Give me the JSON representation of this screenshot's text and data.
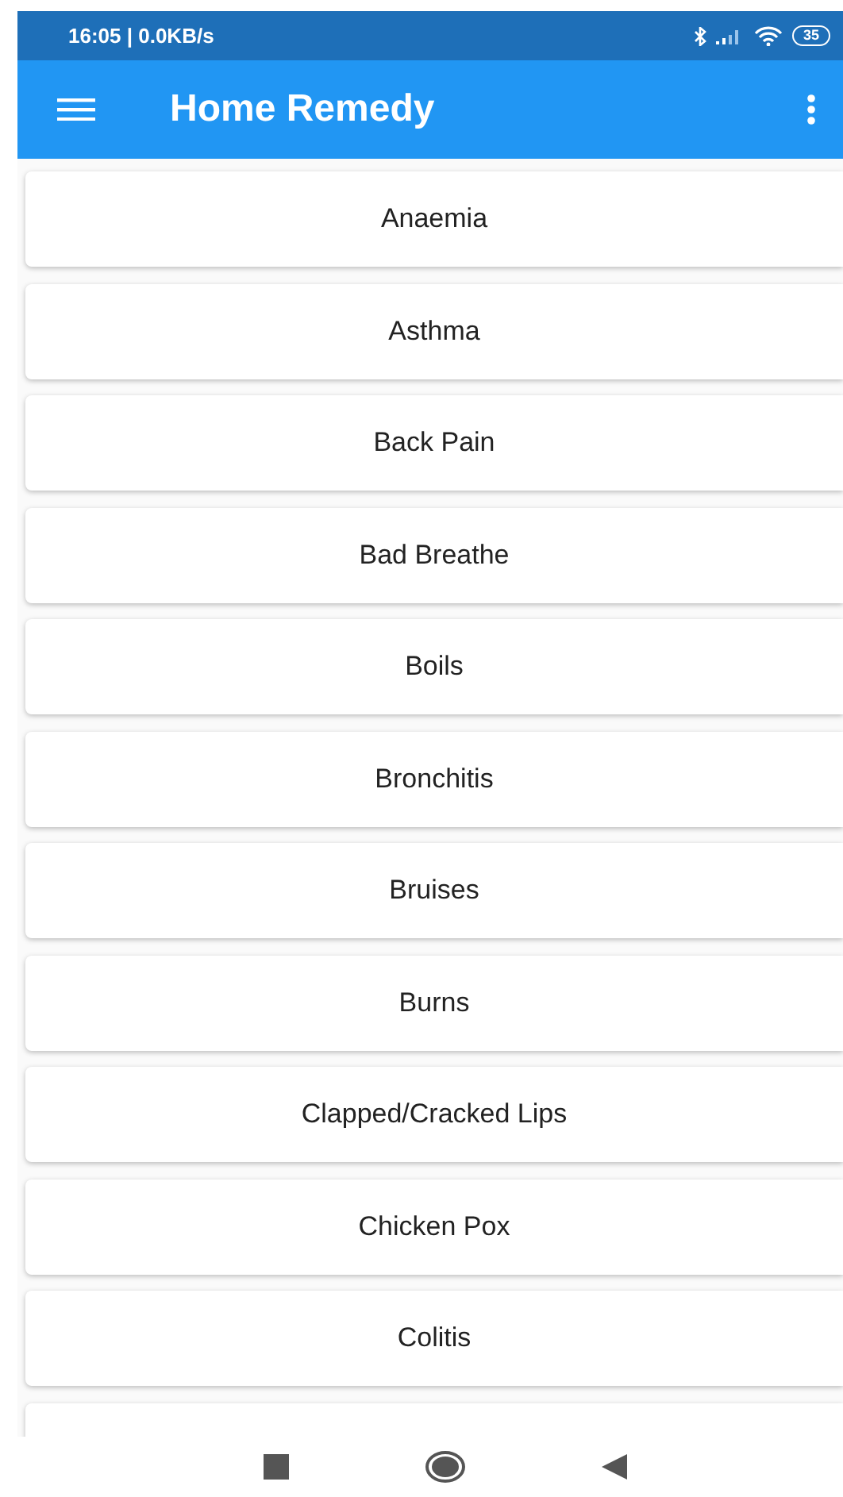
{
  "status_bar": {
    "text": "16:05 | 0.0KB/s",
    "battery": "35"
  },
  "app_bar": {
    "title": "Home Remedy"
  },
  "remedies": [
    {
      "label": "Anaemia"
    },
    {
      "label": "Asthma"
    },
    {
      "label": "Back Pain"
    },
    {
      "label": "Bad Breathe"
    },
    {
      "label": "Boils"
    },
    {
      "label": "Bronchitis"
    },
    {
      "label": "Bruises"
    },
    {
      "label": "Burns"
    },
    {
      "label": "Clapped/Cracked Lips"
    },
    {
      "label": "Chicken Pox"
    },
    {
      "label": "Colitis"
    }
  ]
}
